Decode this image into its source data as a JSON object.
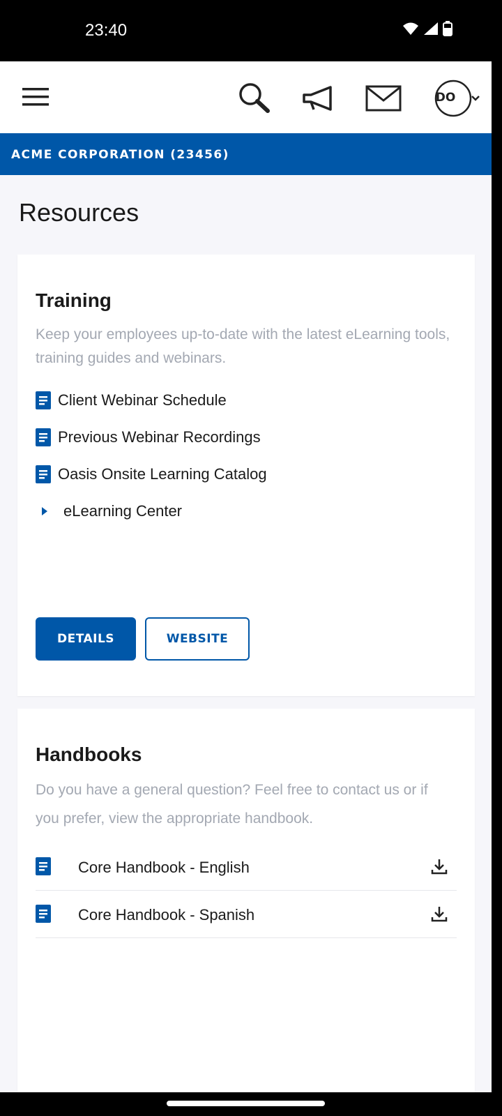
{
  "status": {
    "time": "23:40"
  },
  "topbar": {
    "menu_icon": "hamburger-menu-icon",
    "search_icon": "search-icon",
    "announcement_icon": "megaphone-icon",
    "mail_icon": "mail-icon",
    "avatar_initials": "DO"
  },
  "company": {
    "name": "ACME CORPORATION (23456)"
  },
  "page": {
    "title": "Resources"
  },
  "training": {
    "title": "Training",
    "description": "Keep your employees up-to-date with the latest eLearning tools, training guides and webinars.",
    "links": [
      {
        "label": "Client Webinar Schedule",
        "icon": "document-icon"
      },
      {
        "label": "Previous Webinar Recordings",
        "icon": "document-icon"
      },
      {
        "label": "Oasis Onsite Learning Catalog",
        "icon": "document-icon"
      },
      {
        "label": "eLearning Center",
        "icon": "caret-right-icon"
      }
    ],
    "details_label": "DETAILS",
    "website_label": "WEBSITE"
  },
  "handbooks": {
    "title": "Handbooks",
    "description": "Do you have a general question? Feel free to contact us or if you prefer, view the appropriate handbook.",
    "items": [
      {
        "label": "Core Handbook - English",
        "icon": "document-icon",
        "action_icon": "download-icon"
      },
      {
        "label": "Core Handbook - Spanish",
        "icon": "document-icon",
        "action_icon": "download-icon"
      }
    ]
  },
  "colors": {
    "brand": "#0057a8",
    "muted_text": "#a3a8b2",
    "background": "#f6f6fa"
  }
}
